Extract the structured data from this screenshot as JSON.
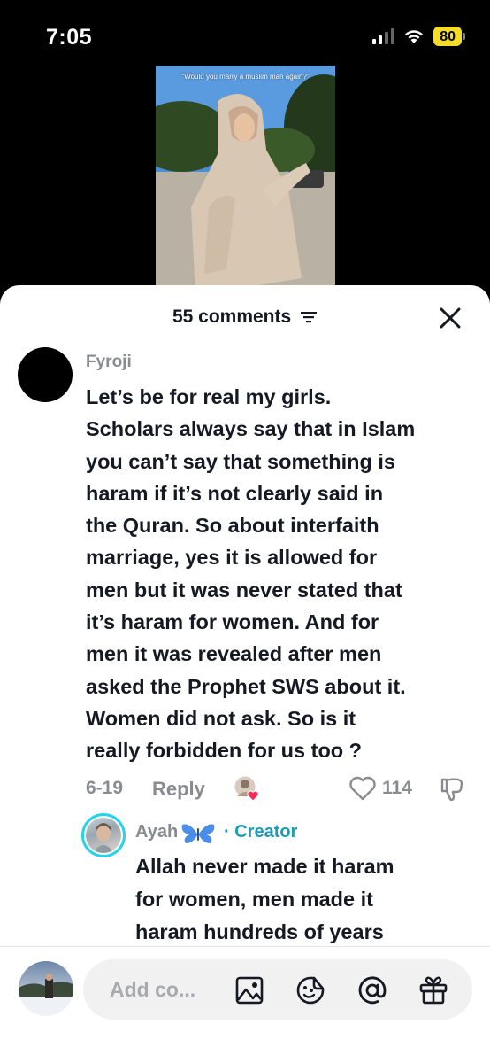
{
  "status_bar": {
    "time": "7:05",
    "battery": "80"
  },
  "video": {
    "caption": "\"Would you marry a muslim man again?\""
  },
  "sheet": {
    "comments_count": "55 comments"
  },
  "comment": {
    "username": "Fyroji",
    "lines": [
      "Let’s be for real my girls.",
      "Scholars always say that in Islam",
      "you can’t say that something is",
      "haram if it’s not clearly said in",
      "the Quran. So about interfaith",
      "marriage, yes it is allowed for",
      "men but it was never stated that",
      "it’s haram for women. And for",
      "men it was revealed after men",
      "asked the Prophet SWS about it.",
      "Women did not ask. So is it",
      "really forbidden for us too ?"
    ],
    "date": "6-19",
    "reply_label": "Reply",
    "likes": "114"
  },
  "reply": {
    "username": "Ayah",
    "creator_label": "· Creator",
    "lines": [
      "Allah never made it haram",
      "for women, men made it",
      "haram hundreds of years"
    ]
  },
  "composer": {
    "placeholder": "Add co..."
  },
  "icons": {
    "sort": "sort-lines-icon",
    "close": "close-icon",
    "like": "heart-outline-icon",
    "dislike": "thumbs-down-icon",
    "butterfly": "butterfly-icon",
    "image": "image-icon",
    "emoji": "emoji-icon",
    "mention": "at-icon",
    "gift": "gift-icon"
  },
  "colors": {
    "creator_accent": "#1a9bb8",
    "battery": "#f4dc2b",
    "like_heart": "#fe2c55"
  }
}
